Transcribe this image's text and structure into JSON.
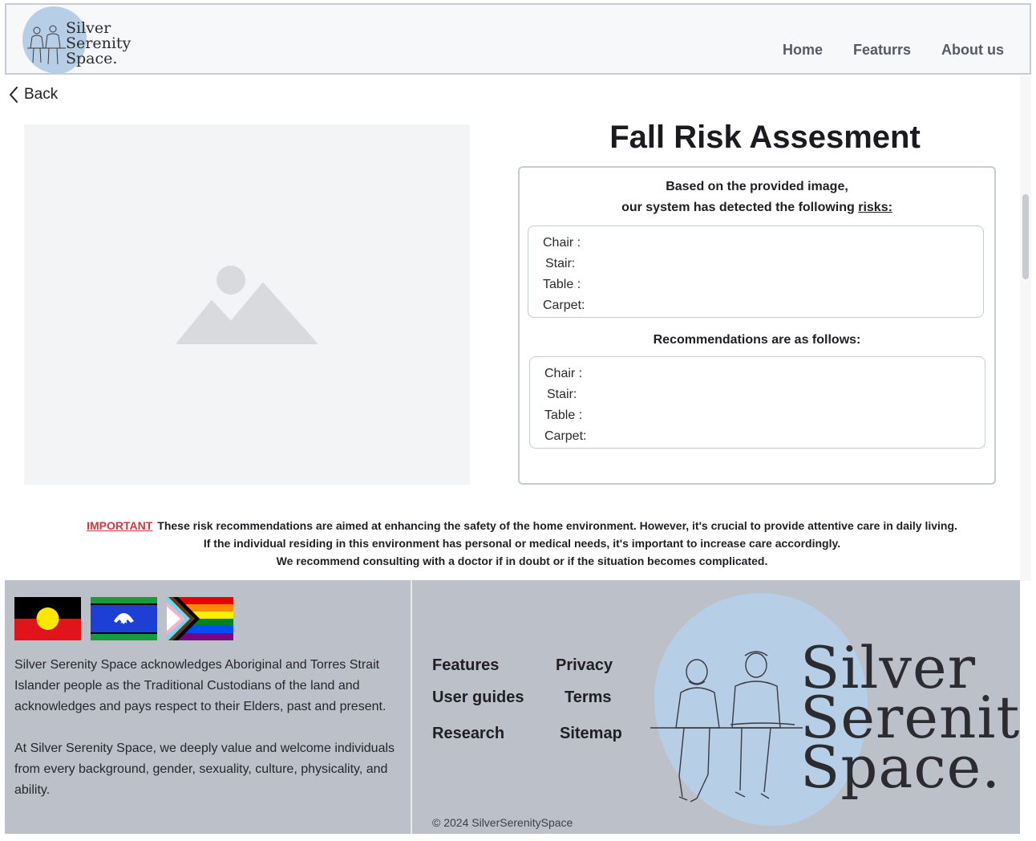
{
  "brand": {
    "line1": "Silver",
    "line2": "Serenity",
    "line3": "Space."
  },
  "nav": {
    "home": "Home",
    "features": "Featurrs",
    "about": "About us"
  },
  "back": {
    "label": "Back"
  },
  "assessment": {
    "title": "Fall Risk Assesment",
    "intro_line1": "Based on the provided image,",
    "intro_line2_prefix": "our system has detected the following ",
    "intro_line2_link": "risks:",
    "risks": [
      "Chair :",
      "Stair:",
      "Table :",
      "Carpet:"
    ],
    "recommendations_heading": "Recommendations are as follows:",
    "recommendations": [
      "Chair :",
      "Stair:",
      "Table :",
      "Carpet:"
    ]
  },
  "notice": {
    "important": "IMPORTANT",
    "line1": "These risk recommendations are aimed at enhancing the safety of the home environment.  However, it's crucial to provide attentive care in daily living.",
    "line2": "If the individual residing in this environment has personal or medical needs, it's important to increase care accordingly.",
    "line3": "We recommend consulting with a doctor if in doubt or if the situation becomes complicated."
  },
  "footer": {
    "acknowledgement": "Silver Serenity Space acknowledges Aboriginal and Torres Strait Islander people as the Traditional Custodians of the land  and acknowledges and pays respect to their Elders, past and present.",
    "welcome": "At Silver Serenity Space, we deeply value and welcome individuals from every background, gender, sexuality, culture, physicality, and ability.",
    "links": {
      "features": "Features",
      "privacy": "Privacy",
      "user_guides": "User guides",
      "terms": "Terms",
      "research": "Research",
      "sitemap": "Sitemap"
    },
    "copyright": "© 2024 SilverSerenitySpace"
  },
  "colors": {
    "accent_blob": "#b6cfe6",
    "important": "#d6343b",
    "footer_bg": "#bcc0c9"
  }
}
